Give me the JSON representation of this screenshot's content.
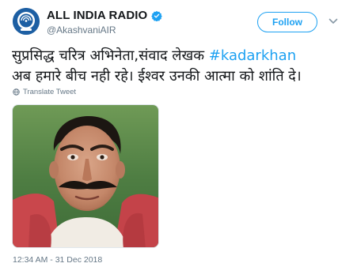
{
  "account": {
    "display_name": "ALL INDIA RADIO",
    "handle": "@AkashvaniAIR",
    "verified": true
  },
  "actions": {
    "follow_label": "Follow"
  },
  "tweet": {
    "text_line1_prefix": "सुप्रसिद्ध चरित्र अभिनेता,संवाद लेखक ",
    "hashtag": "#kadarkhan",
    "text_line2": "अब हमारे बीच नही रहे। ईश्वर उनकी आत्मा को शांति दे।",
    "translate_label": "Translate Tweet",
    "timestamp": "12:34 AM - 31 Dec 2018"
  },
  "colors": {
    "accent": "#1da1f2",
    "secondary_text": "#657786",
    "avatar_bg": "#1d5fa3"
  },
  "icons": {
    "verified": "verified-badge-icon",
    "menu": "chevron-down-icon",
    "translate": "globe-icon"
  }
}
